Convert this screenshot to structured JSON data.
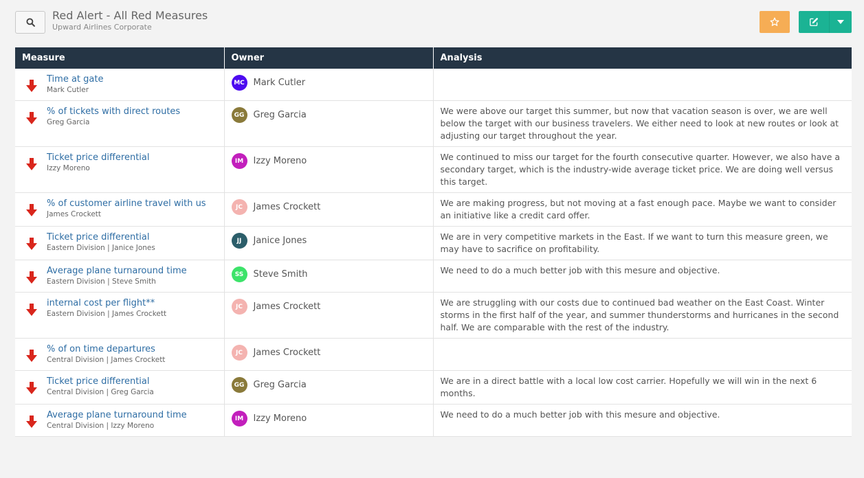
{
  "header": {
    "title": "Red Alert - All Red Measures",
    "subtitle": "Upward Airlines Corporate"
  },
  "colors": {
    "header_bg": "#253545",
    "star_button": "#f6ad55",
    "edit_button": "#1bb394",
    "link": "#2e6da4",
    "alert_arrow": "#d9261c"
  },
  "icons": {
    "search": "search-icon",
    "star": "star-icon",
    "edit": "edit-icon",
    "dropdown": "caret-down-icon",
    "status": "arrow-down-icon"
  },
  "table": {
    "columns": [
      "Measure",
      "Owner",
      "Analysis"
    ],
    "rows": [
      {
        "measure": "Time at gate",
        "sub": "Mark Cutler",
        "initials": "MC",
        "avatar_color": "#4d0bf0",
        "owner": "Mark Cutler",
        "analysis": ""
      },
      {
        "measure": "% of tickets with direct routes",
        "sub": "Greg Garcia",
        "initials": "GG",
        "avatar_color": "#8a7a3a",
        "owner": "Greg Garcia",
        "analysis": "We were above our target this summer, but now that vacation season is over, we are well below the target with our business travelers.  We either need to look at new routes or look at adjusting our target throughout the year."
      },
      {
        "measure": "Ticket price differential",
        "sub": "Izzy Moreno",
        "initials": "IM",
        "avatar_color": "#c21fbc",
        "owner": "Izzy Moreno",
        "analysis": "We continued to miss our target for the fourth consecutive quarter. However, we also have a  secondary target, which is the industry-wide average ticket price.  We are doing well versus this target."
      },
      {
        "measure": "% of customer airline travel with us",
        "sub": "James Crockett",
        "initials": "JC",
        "avatar_color": "#f4b3b0",
        "owner": "James Crockett",
        "analysis": "We are making progress, but not moving at a fast enough pace. Maybe we want to consider an initiative like a credit card offer."
      },
      {
        "measure": "Ticket price differential",
        "sub": "Eastern Division | Janice Jones",
        "initials": "JJ",
        "avatar_color": "#2c5e6a",
        "owner": "Janice Jones",
        "analysis": "We are in very competitive markets in the East.  If we want to turn this measure green, we may have to sacrifice on profitability."
      },
      {
        "measure": "Average plane turnaround time",
        "sub": "Eastern Division | Steve Smith",
        "initials": "SS",
        "avatar_color": "#3de36a",
        "owner": "Steve Smith",
        "analysis": "We need to do a much better job with this mesure and objective."
      },
      {
        "measure": "internal cost per flight**",
        "sub": "Eastern Division | James Crockett",
        "initials": "JC",
        "avatar_color": "#f4b3b0",
        "owner": "James Crockett",
        "analysis": "We are struggling with our costs due to continued bad weather on the East Coast.  Winter storms in the first half of the year, and summer thunderstorms and hurricanes in the second half.  We are comparable with the rest of the industry."
      },
      {
        "measure": "% of on time departures",
        "sub": "Central Division | James Crockett",
        "initials": "JC",
        "avatar_color": "#f4b3b0",
        "owner": "James Crockett",
        "analysis": ""
      },
      {
        "measure": "Ticket price differential",
        "sub": "Central Division | Greg Garcia",
        "initials": "GG",
        "avatar_color": "#8a7a3a",
        "owner": "Greg Garcia",
        "analysis": "We are in a direct battle with a local low cost carrier.  Hopefully we will win in the next 6 months."
      },
      {
        "measure": "Average plane turnaround time",
        "sub": "Central Division | Izzy Moreno",
        "initials": "IM",
        "avatar_color": "#c21fbc",
        "owner": "Izzy Moreno",
        "analysis": "We need to do a much better job with this mesure and objective."
      }
    ]
  }
}
